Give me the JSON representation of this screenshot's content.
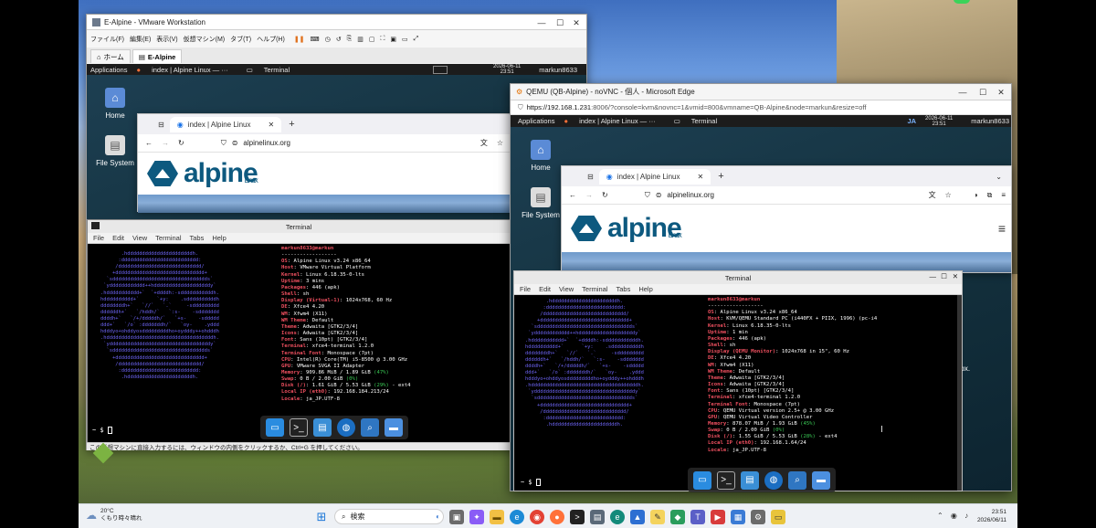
{
  "vmware": {
    "title": "E-Alpine - VMware Workstation",
    "menu": [
      "ファイル(F)",
      "編集(E)",
      "表示(V)",
      "仮想マシン(M)",
      "タブ(T)",
      "ヘルプ(H)"
    ],
    "tabs": [
      "ホーム",
      "E-Alpine"
    ],
    "status_text": "この仮想マシンに直接入力するには、ウィンドウの内側をクリックするか、Ctrl+G を押してください。"
  },
  "vm1": {
    "panel": {
      "apps": "Applications",
      "task1": "index | Alpine Linux — ···",
      "task2": "Terminal",
      "date": "2026-06-11",
      "time": "23:51",
      "user": "markun8633"
    },
    "desktop_icons": [
      "Home",
      "File System"
    ],
    "browser": {
      "tab": "index | Alpine Linux",
      "url": "alpinelinux.org",
      "logo_word": "alpine",
      "logo_sub": "Linux"
    },
    "terminal": {
      "title": "Terminal",
      "menu": [
        "File",
        "Edit",
        "View",
        "Terminal",
        "Tabs",
        "Help"
      ],
      "header": "markun8633@markun",
      "sep": "------------------",
      "lines": [
        {
          "k": "OS",
          "v": "Alpine Linux v3.24 x86_64"
        },
        {
          "k": "Host",
          "v": "VMware Virtual Platform"
        },
        {
          "k": "Kernel",
          "v": "Linux 6.18.35-0-lts"
        },
        {
          "k": "Uptime",
          "v": "3 mins"
        },
        {
          "k": "Packages",
          "v": "446 (apk)"
        },
        {
          "k": "Shell",
          "v": "sh"
        },
        {
          "k": "Display (Virtual-1)",
          "v": "1024x768, 60 Hz"
        },
        {
          "k": "DE",
          "v": "Xfce4 4.20"
        },
        {
          "k": "WM",
          "v": "Xfwm4 (X11)"
        },
        {
          "k": "WM Theme",
          "v": "Default"
        },
        {
          "k": "Theme",
          "v": "Adwaita [GTK2/3/4]"
        },
        {
          "k": "Icons",
          "v": "Adwaita [GTK2/3/4]"
        },
        {
          "k": "Font",
          "v": "Sans (10pt) [GTK2/3/4]"
        },
        {
          "k": "Terminal",
          "v": "xfce4-terminal 1.2.0"
        },
        {
          "k": "Terminal Font",
          "v": "Monospace (7pt)"
        },
        {
          "k": "CPU",
          "v": "Intel(R) Core(TM) i5-8500 @ 3.00 GHz"
        },
        {
          "k": "GPU",
          "v": "VMware SVGA II Adapter"
        },
        {
          "k": "Memory",
          "v": "909.86 MiB / 1.89 GiB",
          "p": "(47%)"
        },
        {
          "k": "Swap",
          "v": "0 B / 2.00 GiB",
          "p": "(0%)"
        },
        {
          "k": "Disk (/)",
          "v": "1.61 GiB / 5.53 GiB",
          "p": "(29%)",
          "t": " - ext4"
        },
        {
          "k": "Local IP (eth0)",
          "v": "192.168.184.213/24"
        },
        {
          "k": "Locale",
          "v": "ja_JP.UTF-8"
        }
      ],
      "prompt": "~ $"
    }
  },
  "edge": {
    "title": "QEMU (QB-Alpine) - noVNC - 個人 - Microsoft Edge",
    "url_host": "https://192.168.1.231",
    "url_rest": ":8006/?console=kvm&novnc=1&vmid=800&vmname=QB-Alpine&node=markun&resize=off"
  },
  "vm2": {
    "panel": {
      "apps": "Applications",
      "task1": "index | Alpine Linux — ···",
      "task2": "Terminal",
      "ime": "JA",
      "date": "2026-06-11",
      "time": "23:51",
      "user": "markun8633"
    },
    "desktop_icons": [
      "Home",
      "File System"
    ],
    "browser": {
      "tab": "index | Alpine Linux",
      "url": "alpinelinux.org",
      "logo_word": "alpine",
      "logo_sub": "Linux"
    },
    "terminal": {
      "title": "Terminal",
      "menu": [
        "File",
        "Edit",
        "View",
        "Terminal",
        "Tabs",
        "Help"
      ],
      "header": "markun8633@markun",
      "sep": "------------------",
      "lines": [
        {
          "k": "OS",
          "v": "Alpine Linux v3.24 x86_64"
        },
        {
          "k": "Host",
          "v": "KVM/QEMU Standard PC (i440FX + PIIX, 1996) (pc-i4"
        },
        {
          "k": "Kernel",
          "v": "Linux 6.18.35-0-lts"
        },
        {
          "k": "Uptime",
          "v": "1 min"
        },
        {
          "k": "Packages",
          "v": "446 (apk)"
        },
        {
          "k": "Shell",
          "v": "sh"
        },
        {
          "k": "Display (QEMU Monitor)",
          "v": "1024x768 in 15\", 60 Hz"
        },
        {
          "k": "DE",
          "v": "Xfce4 4.20"
        },
        {
          "k": "WM",
          "v": "Xfwm4 (X11)"
        },
        {
          "k": "WM Theme",
          "v": "Default"
        },
        {
          "k": "Theme",
          "v": "Adwaita [GTK2/3/4]"
        },
        {
          "k": "Icons",
          "v": "Adwaita [GTK2/3/4]"
        },
        {
          "k": "Font",
          "v": "Sans (10pt) [GTK2/3/4]"
        },
        {
          "k": "Terminal",
          "v": "xfce4-terminal 1.2.0"
        },
        {
          "k": "Terminal Font",
          "v": "Monospace (7pt)"
        },
        {
          "k": "CPU",
          "v": "QEMU Virtual version 2.5+ @ 3.00 GHz"
        },
        {
          "k": "GPU",
          "v": "QEMU Virtual Video Controller"
        },
        {
          "k": "Memory",
          "v": "878.07 MiB / 1.93 GiB",
          "p": "(45%)"
        },
        {
          "k": "Swap",
          "v": "0 B / 2.00 GiB",
          "p": "(0%)"
        },
        {
          "k": "Disk (/)",
          "v": "1.55 GiB / 5.53 GiB",
          "p": "(28%)",
          "t": " - ext4"
        },
        {
          "k": "Local IP (eth0)",
          "v": "192.168.1.64/24"
        },
        {
          "k": "Locale",
          "v": "ja_JP.UTF-8"
        }
      ],
      "prompt": "~ $"
    }
  },
  "side_text": "box.",
  "taskbar": {
    "weather_temp": "20°C",
    "weather_desc": "くもり時々晴れ",
    "search": "検索",
    "time": "23:51",
    "date": "2026/06/11"
  },
  "colors": {
    "alpine_blue": "#0d597f",
    "ascii_purple": "#6c63f2",
    "fetch_key": "#f05060",
    "fetch_pct": "#39c854"
  }
}
